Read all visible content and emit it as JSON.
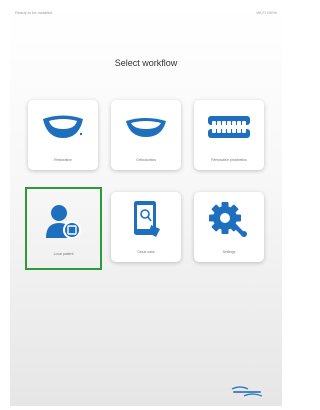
{
  "status_bar": {
    "left": "Ready to be installed",
    "right": "Wi-Fi 100%"
  },
  "title": "Select workflow",
  "tiles": [
    {
      "label": "Restorative",
      "icon": "smile-teeth-icon"
    },
    {
      "label": "Orthodontics",
      "icon": "smile-arch-icon"
    },
    {
      "label": "Removable prosthetics",
      "icon": "dentures-icon"
    },
    {
      "label": "Local patient",
      "icon": "patient-add-icon"
    },
    {
      "label": "Cloud case",
      "icon": "tablet-scan-icon"
    },
    {
      "label": "Settings",
      "icon": "settings-gear-icon"
    }
  ],
  "colors": {
    "accent": "#1f6fbf",
    "selection": "#2e9b3a"
  }
}
